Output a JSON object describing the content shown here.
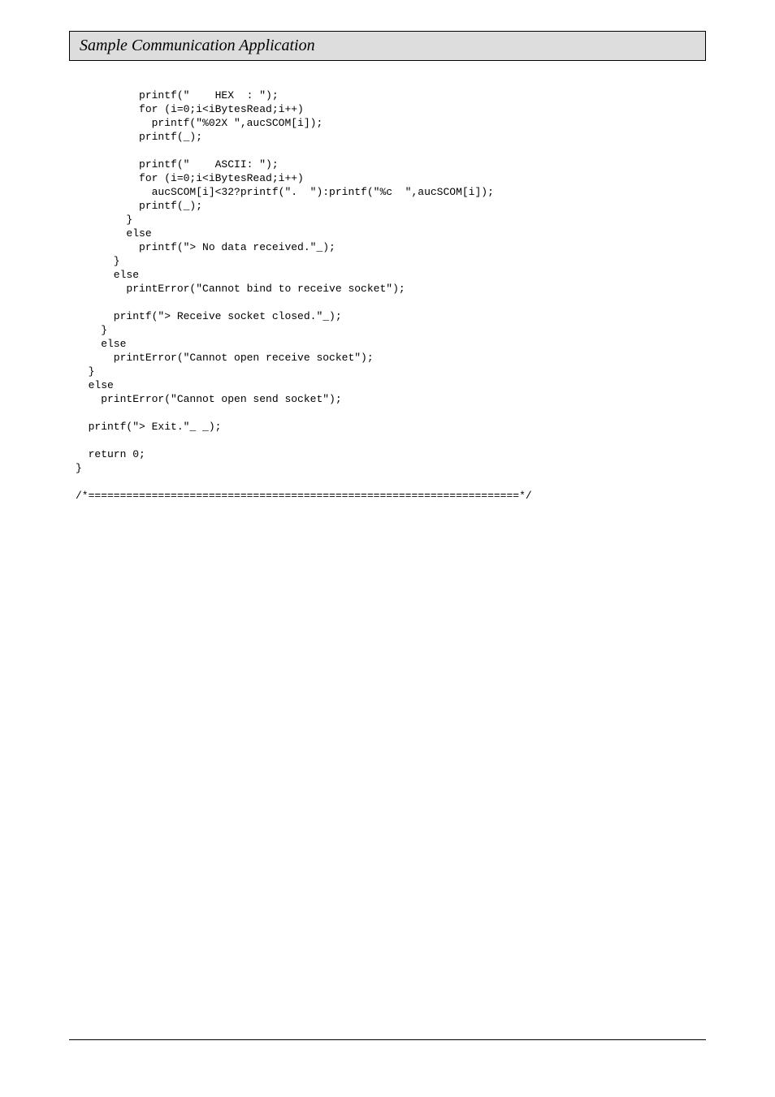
{
  "header": {
    "title": "Sample Communication Application"
  },
  "code": {
    "lines": [
      "          printf(\"    HEX  : \");",
      "          for (i=0;i<iBytesRead;i++)",
      "            printf(\"%02X \",aucSCOM[i]);",
      "          printf(_);",
      "",
      "          printf(\"    ASCII: \");",
      "          for (i=0;i<iBytesRead;i++)",
      "            aucSCOM[i]<32?printf(\".  \"):printf(\"%c  \",aucSCOM[i]);",
      "          printf(_);",
      "        }",
      "        else",
      "          printf(\"> No data received.\"_);",
      "      }",
      "      else",
      "        printError(\"Cannot bind to receive socket\");",
      "",
      "      printf(\"> Receive socket closed.\"_);",
      "    }",
      "    else",
      "      printError(\"Cannot open receive socket\");",
      "  }",
      "  else",
      "    printError(\"Cannot open send socket\");",
      "",
      "  printf(\"> Exit.\"_ _);",
      "",
      "  return 0;",
      "}",
      "",
      "/*====================================================================*/"
    ]
  }
}
